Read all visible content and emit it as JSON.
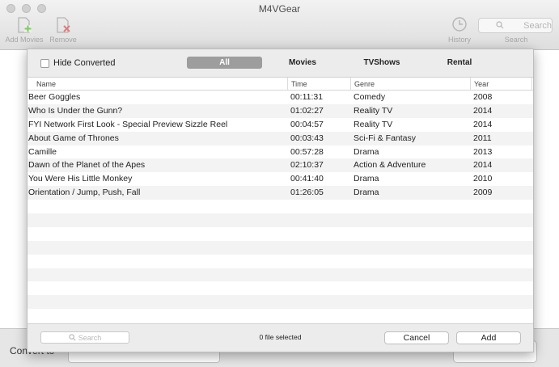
{
  "app": {
    "title": "M4VGear"
  },
  "toolbar": {
    "add_label": "Add Movies",
    "remove_label": "Remove",
    "history_label": "History",
    "search_placeholder": "Search",
    "search_label": "Search"
  },
  "bottom": {
    "convert_label": "Convert to"
  },
  "dialog": {
    "hide_converted_label": "Hide Converted",
    "tabs": [
      {
        "label": "All",
        "active": true
      },
      {
        "label": "Movies",
        "active": false
      },
      {
        "label": "TVShows",
        "active": false
      },
      {
        "label": "Rental",
        "active": false
      }
    ],
    "columns": {
      "name": "Name",
      "time": "Time",
      "genre": "Genre",
      "year": "Year"
    },
    "rows": [
      {
        "name": "Beer Goggles",
        "time": "00:11:31",
        "genre": "Comedy",
        "year": "2008"
      },
      {
        "name": "Who Is Under the Gunn?",
        "time": "01:02:27",
        "genre": "Reality TV",
        "year": "2014"
      },
      {
        "name": "FYI Network First Look - Special Preview Sizzle Reel",
        "time": "00:04:57",
        "genre": "Reality TV",
        "year": "2014"
      },
      {
        "name": "About Game of Thrones",
        "time": "00:03:43",
        "genre": "Sci-Fi & Fantasy",
        "year": "2011"
      },
      {
        "name": "Camille",
        "time": "00:57:28",
        "genre": "Drama",
        "year": "2013"
      },
      {
        "name": "Dawn of the Planet of the Apes",
        "time": "02:10:37",
        "genre": "Action & Adventure",
        "year": "2014"
      },
      {
        "name": "You Were His Little Monkey",
        "time": "00:41:40",
        "genre": "Drama",
        "year": "2010"
      },
      {
        "name": "Orientation / Jump, Push, Fall",
        "time": "01:26:05",
        "genre": "Drama",
        "year": "2009"
      }
    ],
    "search_placeholder": "Search",
    "selected_text": "0 file selected",
    "cancel_label": "Cancel",
    "add_label": "Add"
  }
}
